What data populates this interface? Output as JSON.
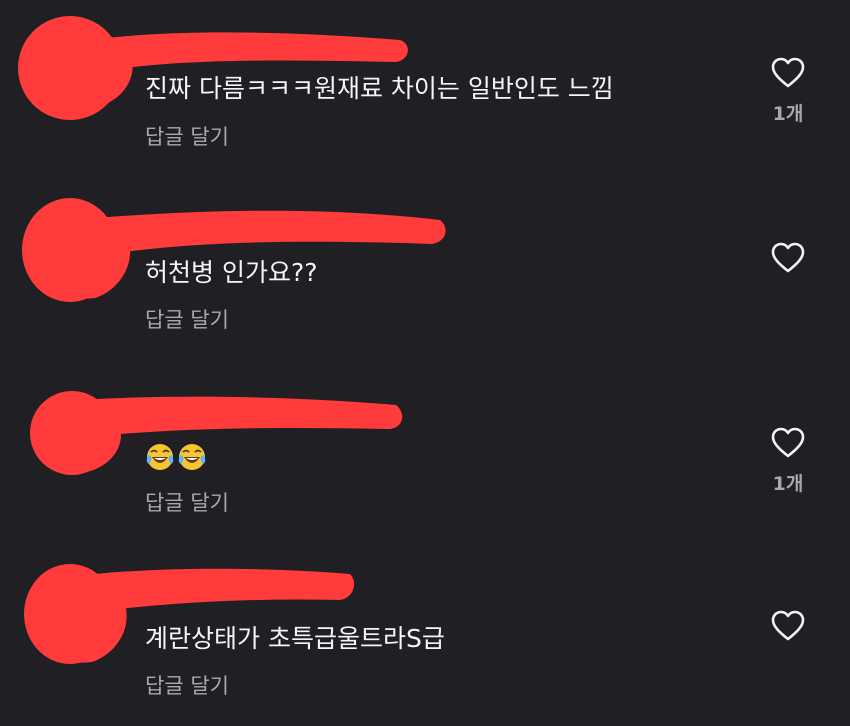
{
  "comments": [
    {
      "text": "진짜 다름ㅋㅋㅋ원재료 차이는 일반인도 느낌",
      "reply_label": "답글 달기",
      "like_count": "1개"
    },
    {
      "text": "허천병 인가요??",
      "reply_label": "답글 달기",
      "like_count": ""
    },
    {
      "text": "",
      "emojis": [
        "face-with-tears-of-joy",
        "face-with-tears-of-joy"
      ],
      "reply_label": "답글 달기",
      "like_count": "1개"
    },
    {
      "text": "계란상태가 초특급울트라S급",
      "reply_label": "답글 달기",
      "like_count": ""
    }
  ],
  "icons": {
    "like": "heart-outline-icon",
    "redaction": "red-scribble-redaction"
  },
  "colors": {
    "background": "#1f1f24",
    "text": "#f5f5f5",
    "secondary_text": "#a8a8ad",
    "redaction": "#ff3b3b"
  }
}
